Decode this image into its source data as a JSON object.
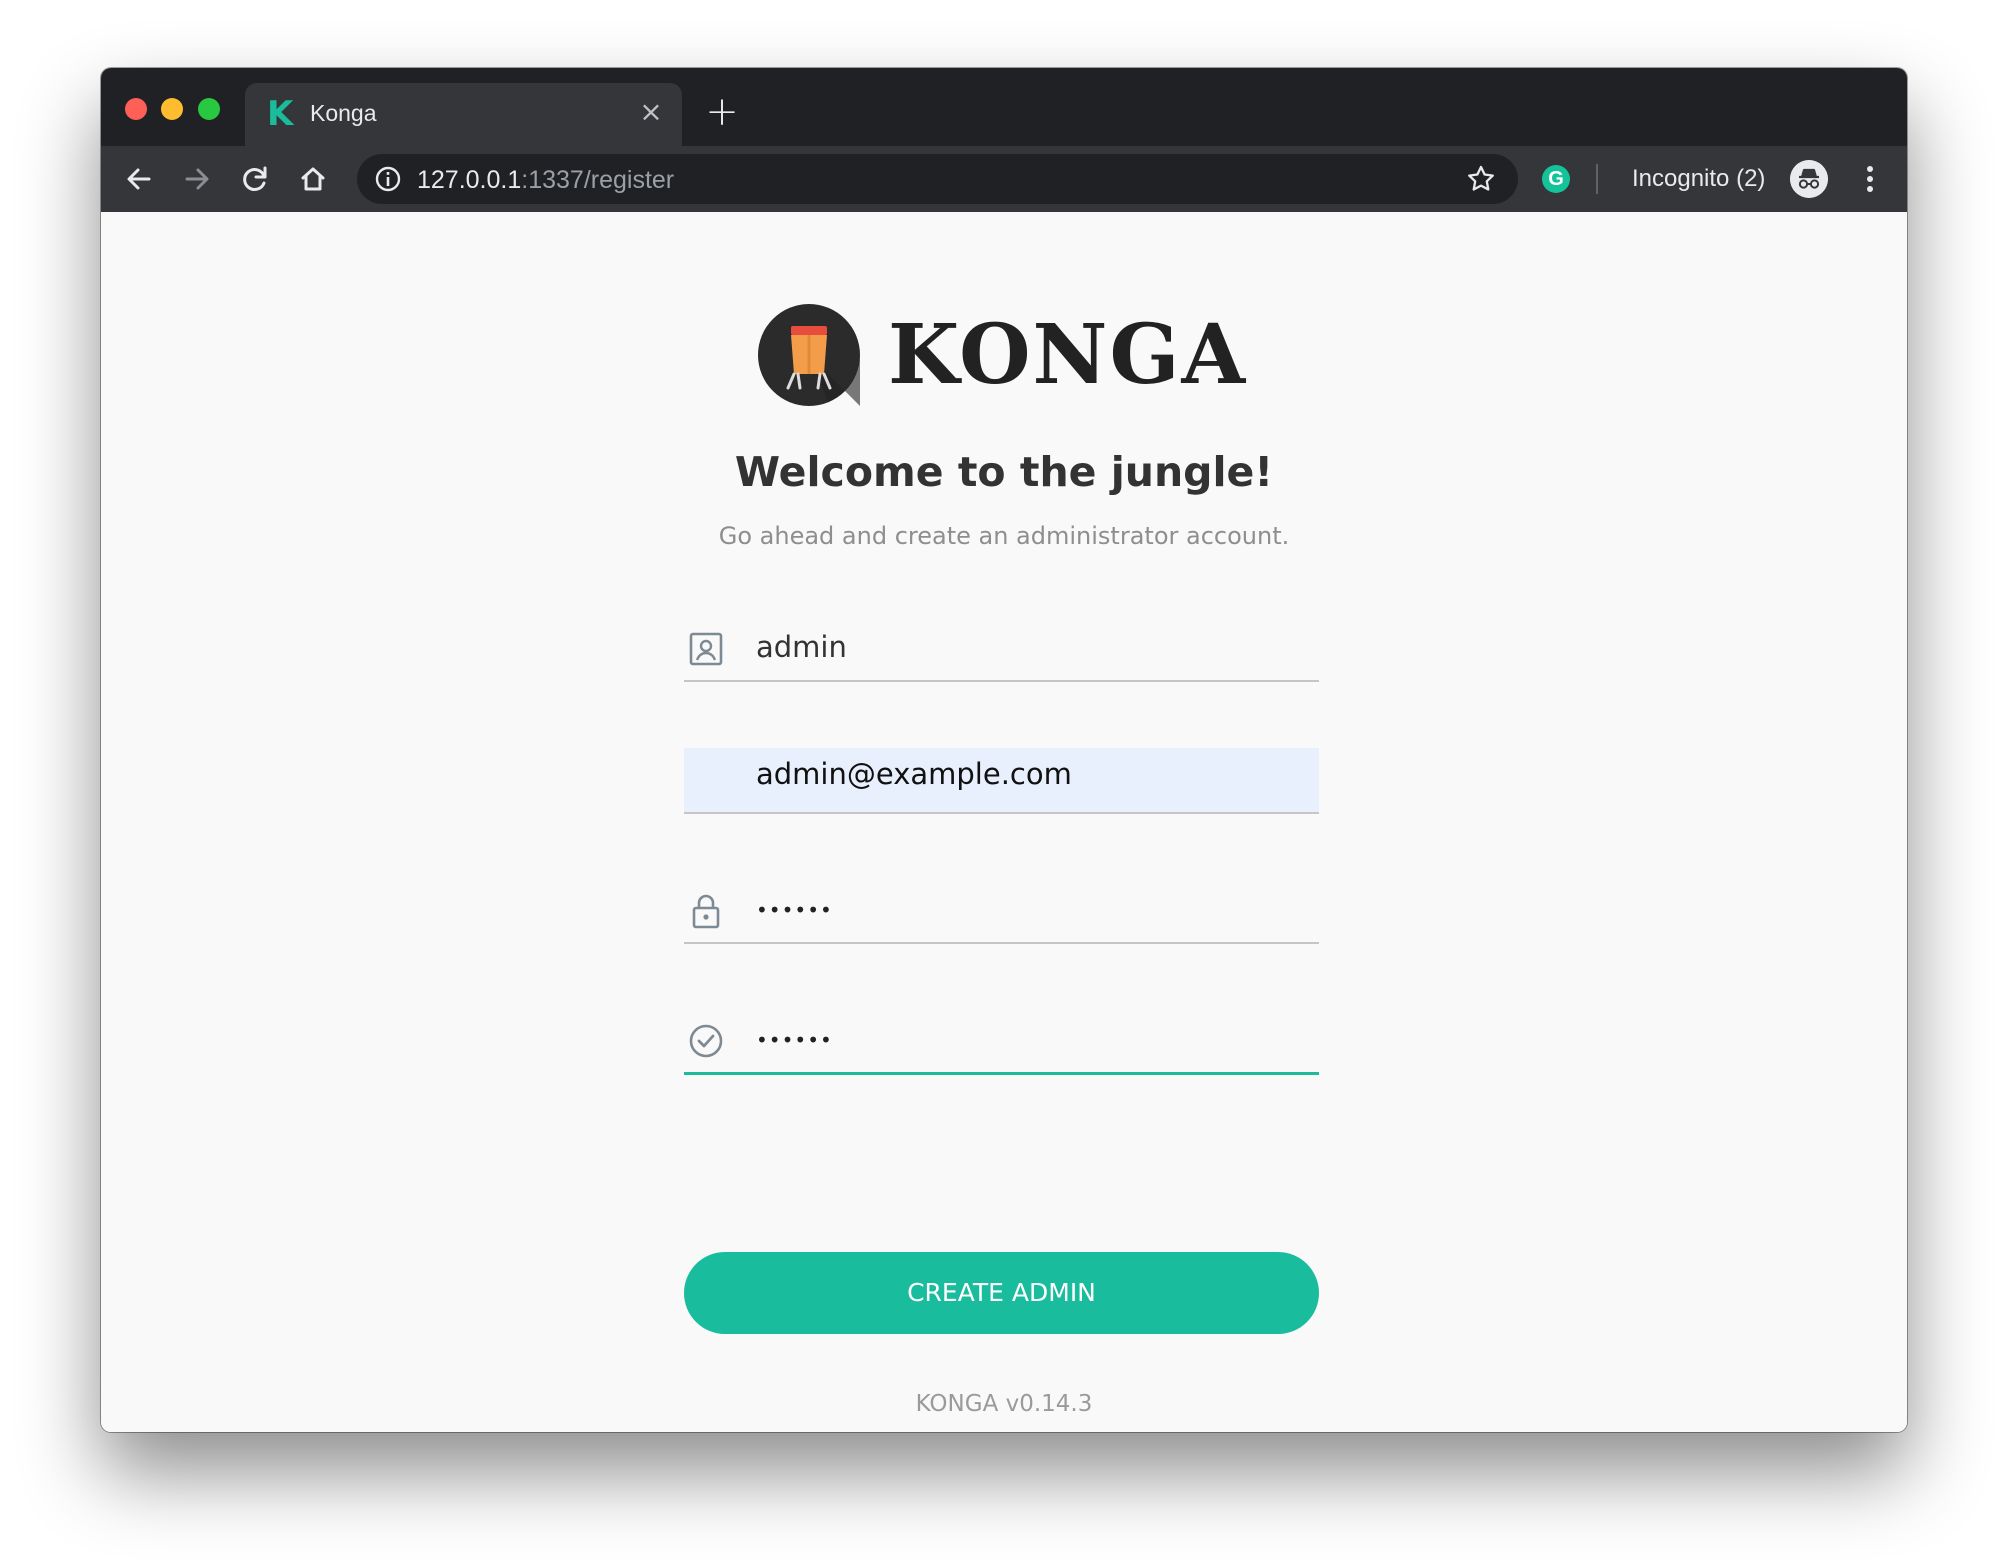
{
  "browser": {
    "tab": {
      "title": "Konga",
      "favicon_letter": "K",
      "close_glyph": "×"
    },
    "new_tab_glyph": "+",
    "address": {
      "host": "127.0.0.1",
      "path": ":1337/register"
    },
    "incognito_label": "Incognito (2)",
    "grammarly_letter": "G",
    "colors": {
      "frame": "#202124",
      "toolbar": "#35363a",
      "accent": "#1abc9c"
    }
  },
  "page": {
    "logo_text": "KONGA",
    "title": "Welcome to the jungle!",
    "subtitle": "Go ahead and create an administrator account.",
    "form": {
      "username": {
        "value": "admin",
        "icon": "user-box-icon"
      },
      "email": {
        "value": "admin@example.com"
      },
      "password": {
        "masked": "••••••",
        "icon": "lock-icon"
      },
      "confirm_password": {
        "masked": "••••••",
        "icon": "check-circle-icon"
      }
    },
    "submit_label": "CREATE ADMIN",
    "version": "KONGA v0.14.3"
  }
}
